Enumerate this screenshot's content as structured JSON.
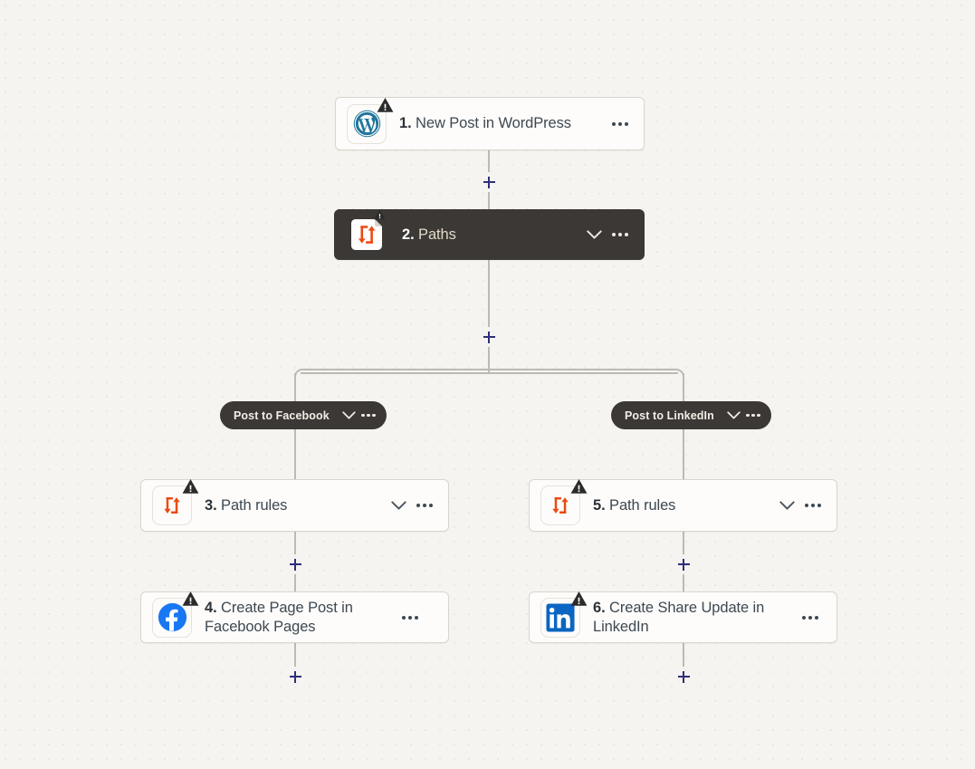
{
  "app": {
    "name": "Zapier Zap Editor Canvas",
    "background_color": "#f6f4f0",
    "accent_color": "#2f2e7a",
    "dark_node_color": "#3b3835",
    "card_color": "#fdfcfa",
    "connector_color": "#bdbab4"
  },
  "steps": [
    {
      "id": "step-1",
      "number": "1.",
      "title": "New Post in WordPress",
      "icon": "wordpress-icon",
      "has_warning": true,
      "has_chevron": false,
      "has_kebab": true,
      "style": "light"
    },
    {
      "id": "step-2",
      "number": "2.",
      "title": "Paths",
      "icon": "paths-icon",
      "has_warning": true,
      "has_chevron": true,
      "has_kebab": true,
      "style": "dark"
    },
    {
      "id": "step-3",
      "number": "3.",
      "title": "Path rules",
      "icon": "paths-icon",
      "has_warning": true,
      "has_chevron": true,
      "has_kebab": true,
      "style": "light"
    },
    {
      "id": "step-4",
      "number": "4.",
      "title": "Create Page Post in Facebook Pages",
      "icon": "facebook-icon",
      "has_warning": true,
      "has_chevron": false,
      "has_kebab": true,
      "style": "light"
    },
    {
      "id": "step-5",
      "number": "5.",
      "title": "Path rules",
      "icon": "paths-icon",
      "has_warning": true,
      "has_chevron": true,
      "has_kebab": true,
      "style": "light"
    },
    {
      "id": "step-6",
      "number": "6.",
      "title": "Create Share Update in LinkedIn",
      "icon": "linkedin-icon",
      "has_warning": true,
      "has_chevron": false,
      "has_kebab": true,
      "style": "light"
    }
  ],
  "paths": [
    {
      "id": "path-a",
      "label": "Post to Facebook",
      "has_chevron": true,
      "has_kebab": true
    },
    {
      "id": "path-b",
      "label": "Post to LinkedIn",
      "has_chevron": true,
      "has_kebab": true
    }
  ],
  "add_buttons": [
    {
      "id": "add-after-step-1",
      "label": "+"
    },
    {
      "id": "add-after-step-2",
      "label": "+"
    },
    {
      "id": "add-after-step-3",
      "label": "+"
    },
    {
      "id": "add-after-step-4",
      "label": "+"
    },
    {
      "id": "add-after-step-5",
      "label": "+"
    },
    {
      "id": "add-after-step-6",
      "label": "+"
    }
  ]
}
